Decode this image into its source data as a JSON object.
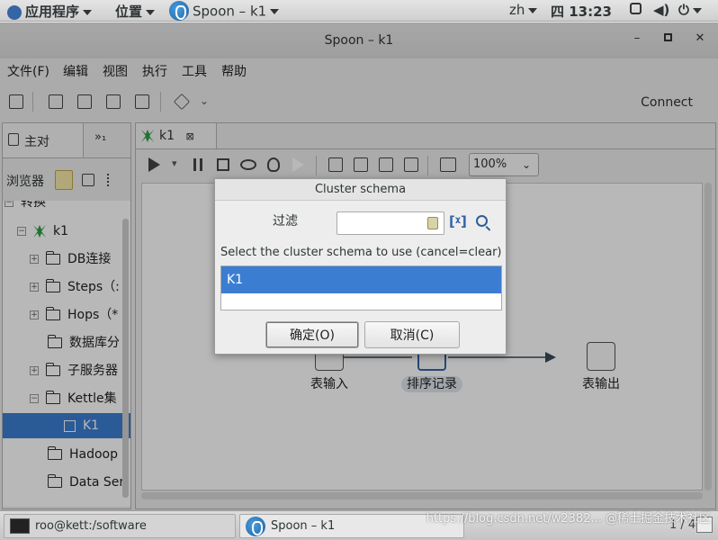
{
  "top_panel": {
    "apps_menu": "应用程序",
    "places_menu": "位置",
    "active_app": "Spoon – k1",
    "input_method": "zh",
    "clock": "四 13:23"
  },
  "window": {
    "title": "Spoon – k1",
    "menus": [
      "文件(F)",
      "编辑",
      "视图",
      "执行",
      "工具",
      "帮助"
    ],
    "connect_label": "Connect"
  },
  "left_panel": {
    "tab_main": "主对",
    "tab_more": "»₁",
    "browser_label": "浏览器",
    "tree_partial_top": "转换",
    "tree": [
      {
        "label": "k1",
        "expander": "⊟"
      },
      {
        "label": "DB连接",
        "expander": "⊞"
      },
      {
        "label": "Steps（:",
        "expander": "⊞"
      },
      {
        "label": "Hops（*",
        "expander": "⊞"
      },
      {
        "label": "数据库分",
        "expander": ""
      },
      {
        "label": "子服务器",
        "expander": "⊞"
      },
      {
        "label": "Kettle集",
        "expander": "⊟"
      },
      {
        "label": "K1",
        "expander": ""
      },
      {
        "label": "Hadoop",
        "expander": ""
      },
      {
        "label": "Data Ser",
        "expander": ""
      }
    ]
  },
  "editor": {
    "tab_label": "k1",
    "zoom": "100%",
    "steps": [
      {
        "label": "表输入"
      },
      {
        "label": "排序记录"
      },
      {
        "label": "表输出"
      }
    ]
  },
  "dialog": {
    "title": "Cluster schema",
    "filter_label": "过滤",
    "filter_value": "",
    "prompt": "Select the cluster schema to use (cancel=clear)",
    "items": [
      "K1"
    ],
    "selected_index": 0,
    "ok_label": "确定(O)",
    "cancel_label": "取消(C)"
  },
  "taskbar": {
    "terminal": "roo@kett:/software",
    "spoon": "Spoon – k1",
    "pager": "1 / 4"
  },
  "watermark": "https://blog.csdn.net/w2382... @稀土掘金技术社区"
}
